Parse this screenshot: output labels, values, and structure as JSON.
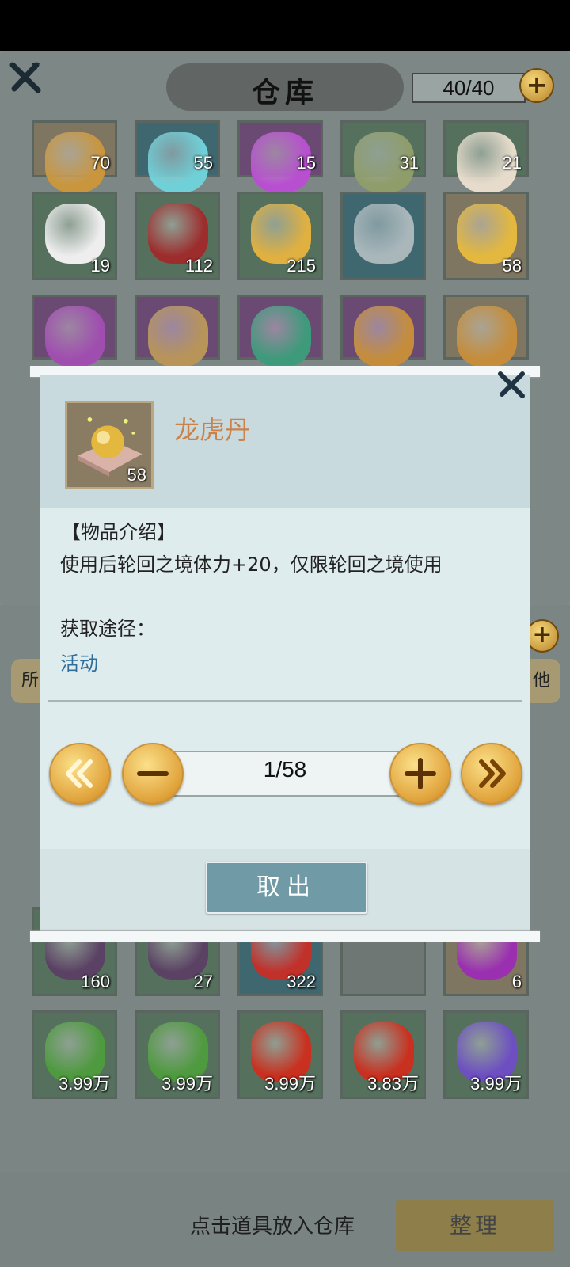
{
  "warehouse": {
    "title": "仓库",
    "capacity": "40/40"
  },
  "warehouse_slots": [
    {
      "count": "70",
      "icon": "golden-chest-icon",
      "quality": "gold"
    },
    {
      "count": "55",
      "icon": "blue-crystal-icon",
      "quality": "blue"
    },
    {
      "count": "15",
      "icon": "purple-heart-gem-icon",
      "quality": "purple"
    },
    {
      "count": "31",
      "icon": "bamboo-slips-icon",
      "quality": "green"
    },
    {
      "count": "21",
      "icon": "porcelain-vase-icon",
      "quality": "green"
    },
    {
      "count": "19",
      "icon": "white-flower-icon",
      "quality": "green"
    },
    {
      "count": "112",
      "icon": "potion-bottle-icon",
      "quality": "green"
    },
    {
      "count": "215",
      "icon": "golden-flame-orb-icon",
      "quality": "green"
    },
    {
      "count": "",
      "icon": "number-3-token-icon",
      "quality": "blue"
    },
    {
      "count": "58",
      "icon": "golden-pill-icon",
      "quality": "gold"
    },
    {
      "count": "",
      "icon": "purple-orb-icon",
      "quality": "purple"
    },
    {
      "count": "",
      "icon": "jade-ornament-icon",
      "quality": "purple"
    },
    {
      "count": "",
      "icon": "green-egg-icon",
      "quality": "purple"
    },
    {
      "count": "",
      "icon": "hourglass-icon",
      "quality": "purple"
    },
    {
      "count": "",
      "icon": "hourglass-icon",
      "quality": "gold"
    }
  ],
  "bag": {
    "tab_left_partial": "所",
    "tab_right_partial": "他",
    "hint": "点击道具放入仓库",
    "sort_label": "整理"
  },
  "bag_slots": [
    {
      "count": "160",
      "icon": "dark-crystal-icon",
      "quality": "green"
    },
    {
      "count": "27",
      "icon": "dark-crystal-icon",
      "quality": "green"
    },
    {
      "count": "322",
      "icon": "gift-box-icon",
      "quality": "blue"
    },
    {
      "count": "",
      "icon": "",
      "quality": "empty"
    },
    {
      "count": "6",
      "icon": "purple-gold-orb-icon",
      "quality": "gold"
    },
    {
      "count": "3.99万",
      "icon": "herb-leaf-icon",
      "quality": "green"
    },
    {
      "count": "3.99万",
      "icon": "herb-leaf-icon",
      "quality": "green"
    },
    {
      "count": "3.99万",
      "icon": "red-berry-icon",
      "quality": "green"
    },
    {
      "count": "3.83万",
      "icon": "red-berry-icon",
      "quality": "green"
    },
    {
      "count": "3.99万",
      "icon": "purple-flower-icon",
      "quality": "green"
    }
  ],
  "dialog": {
    "item_name": "龙虎丹",
    "item_count": "58",
    "intro_heading": "【物品介绍】",
    "intro_text": "使用后轮回之境体力+20，仅限轮回之境使用",
    "source_heading": "获取途径：",
    "source_link": "活动",
    "quantity": "1/58",
    "take_out_label": "取出"
  },
  "colors": {
    "item_name": "#c8824a",
    "source_link": "#2f6e9a",
    "gold_button": "#e0a23a",
    "take_out_button": "#6f9aa6"
  }
}
